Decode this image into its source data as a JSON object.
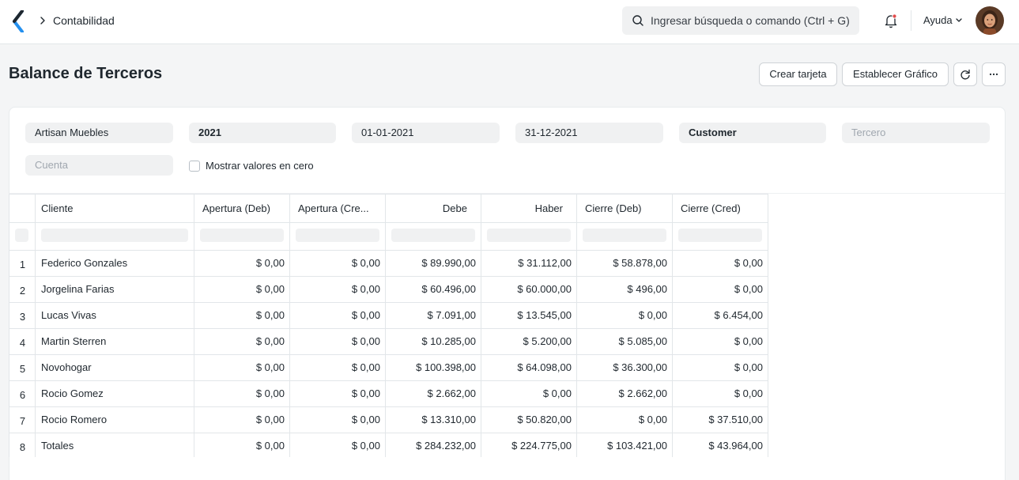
{
  "navbar": {
    "breadcrumb": "Contabilidad",
    "search_placeholder": "Ingresar búsqueda o comando (Ctrl + G)",
    "help_label": "Ayuda"
  },
  "page": {
    "title": "Balance de Terceros",
    "buttons": {
      "create_card": "Crear tarjeta",
      "set_chart": "Establecer Gráfico"
    }
  },
  "filters": {
    "company": "Artisan Muebles",
    "fiscal_year": "2021",
    "from_date": "01-01-2021",
    "to_date": "31-12-2021",
    "party_type": "Customer",
    "party_placeholder": "Tercero",
    "account_placeholder": "Cuenta",
    "show_zero_label": "Mostrar valores en cero",
    "show_zero_checked": false
  },
  "table": {
    "columns": [
      "Cliente",
      "Apertura (Deb)",
      "Apertura (Cre...",
      "Debe",
      "Haber",
      "Cierre (Deb)",
      "Cierre (Cred)"
    ],
    "rows": [
      {
        "n": "1",
        "cells": [
          "Federico Gonzales",
          "$ 0,00",
          "$ 0,00",
          "$ 89.990,00",
          "$ 31.112,00",
          "$ 58.878,00",
          "$ 0,00"
        ]
      },
      {
        "n": "2",
        "cells": [
          "Jorgelina Farias",
          "$ 0,00",
          "$ 0,00",
          "$ 60.496,00",
          "$ 60.000,00",
          "$ 496,00",
          "$ 0,00"
        ]
      },
      {
        "n": "3",
        "cells": [
          "Lucas Vivas",
          "$ 0,00",
          "$ 0,00",
          "$ 7.091,00",
          "$ 13.545,00",
          "$ 0,00",
          "$ 6.454,00"
        ]
      },
      {
        "n": "4",
        "cells": [
          "Martin Sterren",
          "$ 0,00",
          "$ 0,00",
          "$ 10.285,00",
          "$ 5.200,00",
          "$ 5.085,00",
          "$ 0,00"
        ]
      },
      {
        "n": "5",
        "cells": [
          "Novohogar",
          "$ 0,00",
          "$ 0,00",
          "$ 100.398,00",
          "$ 64.098,00",
          "$ 36.300,00",
          "$ 0,00"
        ]
      },
      {
        "n": "6",
        "cells": [
          "Rocio Gomez",
          "$ 0,00",
          "$ 0,00",
          "$ 2.662,00",
          "$ 0,00",
          "$ 2.662,00",
          "$ 0,00"
        ]
      },
      {
        "n": "7",
        "cells": [
          "Rocio Romero",
          "$ 0,00",
          "$ 0,00",
          "$ 13.310,00",
          "$ 50.820,00",
          "$ 0,00",
          "$ 37.510,00"
        ]
      },
      {
        "n": "8",
        "cells": [
          "Totales",
          "$ 0,00",
          "$ 0,00",
          "$ 284.232,00",
          "$ 224.775,00",
          "$ 103.421,00",
          "$ 43.964,00"
        ]
      }
    ]
  },
  "colors": {
    "accent": "#2490ef",
    "notification_dot": "#e24c4c",
    "logo_dark": "#1f272e",
    "logo_blue": "#2490ef"
  }
}
